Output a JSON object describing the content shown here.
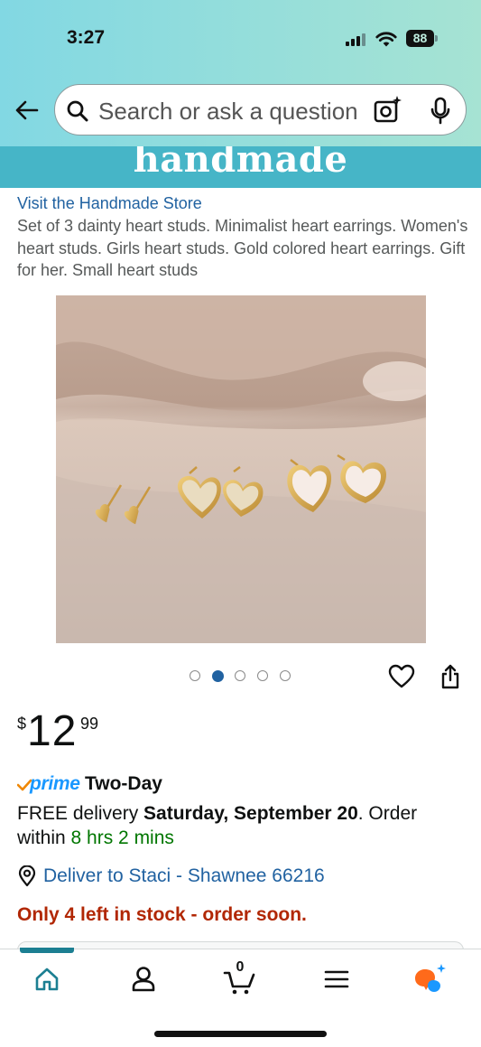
{
  "status_bar": {
    "time": "3:27",
    "battery": "88"
  },
  "search": {
    "placeholder": "Search or ask a question"
  },
  "banner": {
    "text": "handmade"
  },
  "product": {
    "store_link": "Visit the Handmade Store",
    "title": "Set of 3 dainty heart studs. Minimalist heart earrings. Women's heart studs. Girls heart studs. Gold colored heart earrings. Gift for her. Small heart studs",
    "image_count": 5,
    "active_image_index": 1,
    "price": {
      "currency": "$",
      "whole": "12",
      "fraction": "99"
    }
  },
  "delivery": {
    "prime_label": "prime",
    "prime_speed": "Two-Day",
    "free_delivery_prefix": "FREE delivery ",
    "delivery_date": "Saturday, September 20",
    "order_prefix": ". Order within ",
    "countdown": "8 hrs 2 mins",
    "deliver_to": "Deliver to Staci - Shawnee 66216",
    "stock_status": "Only 4 left in stock - order soon."
  },
  "tabbar": {
    "active": "home",
    "items": [
      "home",
      "account",
      "cart",
      "menu",
      "rufus"
    ],
    "cart_count": "0"
  },
  "colors": {
    "link": "#2162a1",
    "prime": "#1a98ff",
    "stock": "#b12704",
    "countdown": "#007600",
    "banner": "#46b5c7",
    "header_start": "#82d8e3",
    "header_end": "#a6e3d3",
    "tab_indicator": "#1c7f92"
  },
  "icons": [
    "back-arrow-icon",
    "search-icon",
    "camera-icon",
    "mic-icon",
    "heart-icon",
    "share-icon",
    "location-pin-icon",
    "home-icon",
    "account-icon",
    "cart-icon",
    "menu-icon",
    "rufus-icon"
  ]
}
